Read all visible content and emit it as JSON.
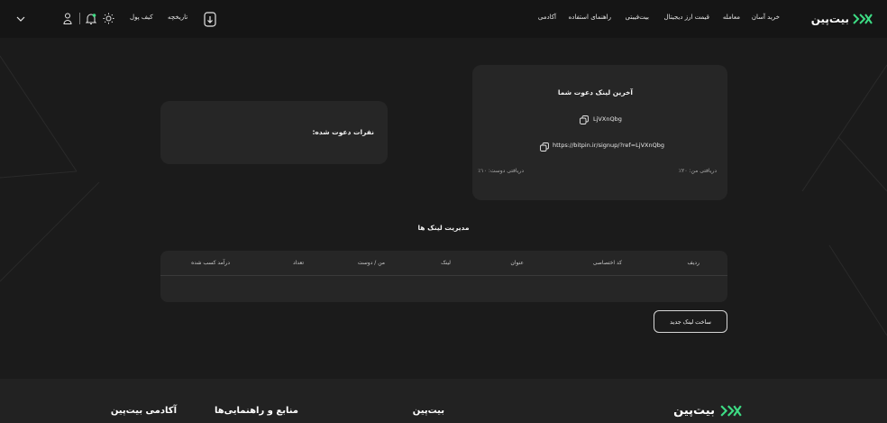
{
  "brand": {
    "name": "بیت‌پین"
  },
  "nav": {
    "items": [
      "خرید آسان",
      "معامله",
      "قیمت ارز دیجیتال",
      "بیت‌فیبتی",
      "راهنمای استفاده",
      "آکادمی"
    ]
  },
  "header_left": {
    "history_label": "تاریخچه",
    "wallet_label": "کیف پول"
  },
  "invite_card": {
    "title": "آخرین لینک دعوت شما",
    "code": "LjVXnQbg",
    "link": "https://bitpin.ir/signup/?ref=LjVXnQbg",
    "my_share": "دریافتی من: ۲۰٪",
    "friend_share": "دریافتی دوست: ۱۰٪"
  },
  "invited_card": {
    "label": "نفرات دعوت شده:"
  },
  "links_section": {
    "title": "مدیریت لینک ها",
    "columns": [
      "ردیف",
      "کد اختصاصی",
      "عنوان",
      "لینک",
      "من / دوست",
      "تعداد",
      "درآمد کسب شده"
    ],
    "rows": [],
    "new_link_label": "ساخت لینک جدید"
  },
  "footer": {
    "columns": [
      "بیت‌پین",
      "منابع و راهنمایی‌ها",
      "آکادمی بیت‌پین"
    ]
  },
  "colors": {
    "background": "#1b1b1b",
    "header": "#151515",
    "card": "#262626",
    "brand_accent": "#3ddc84"
  }
}
